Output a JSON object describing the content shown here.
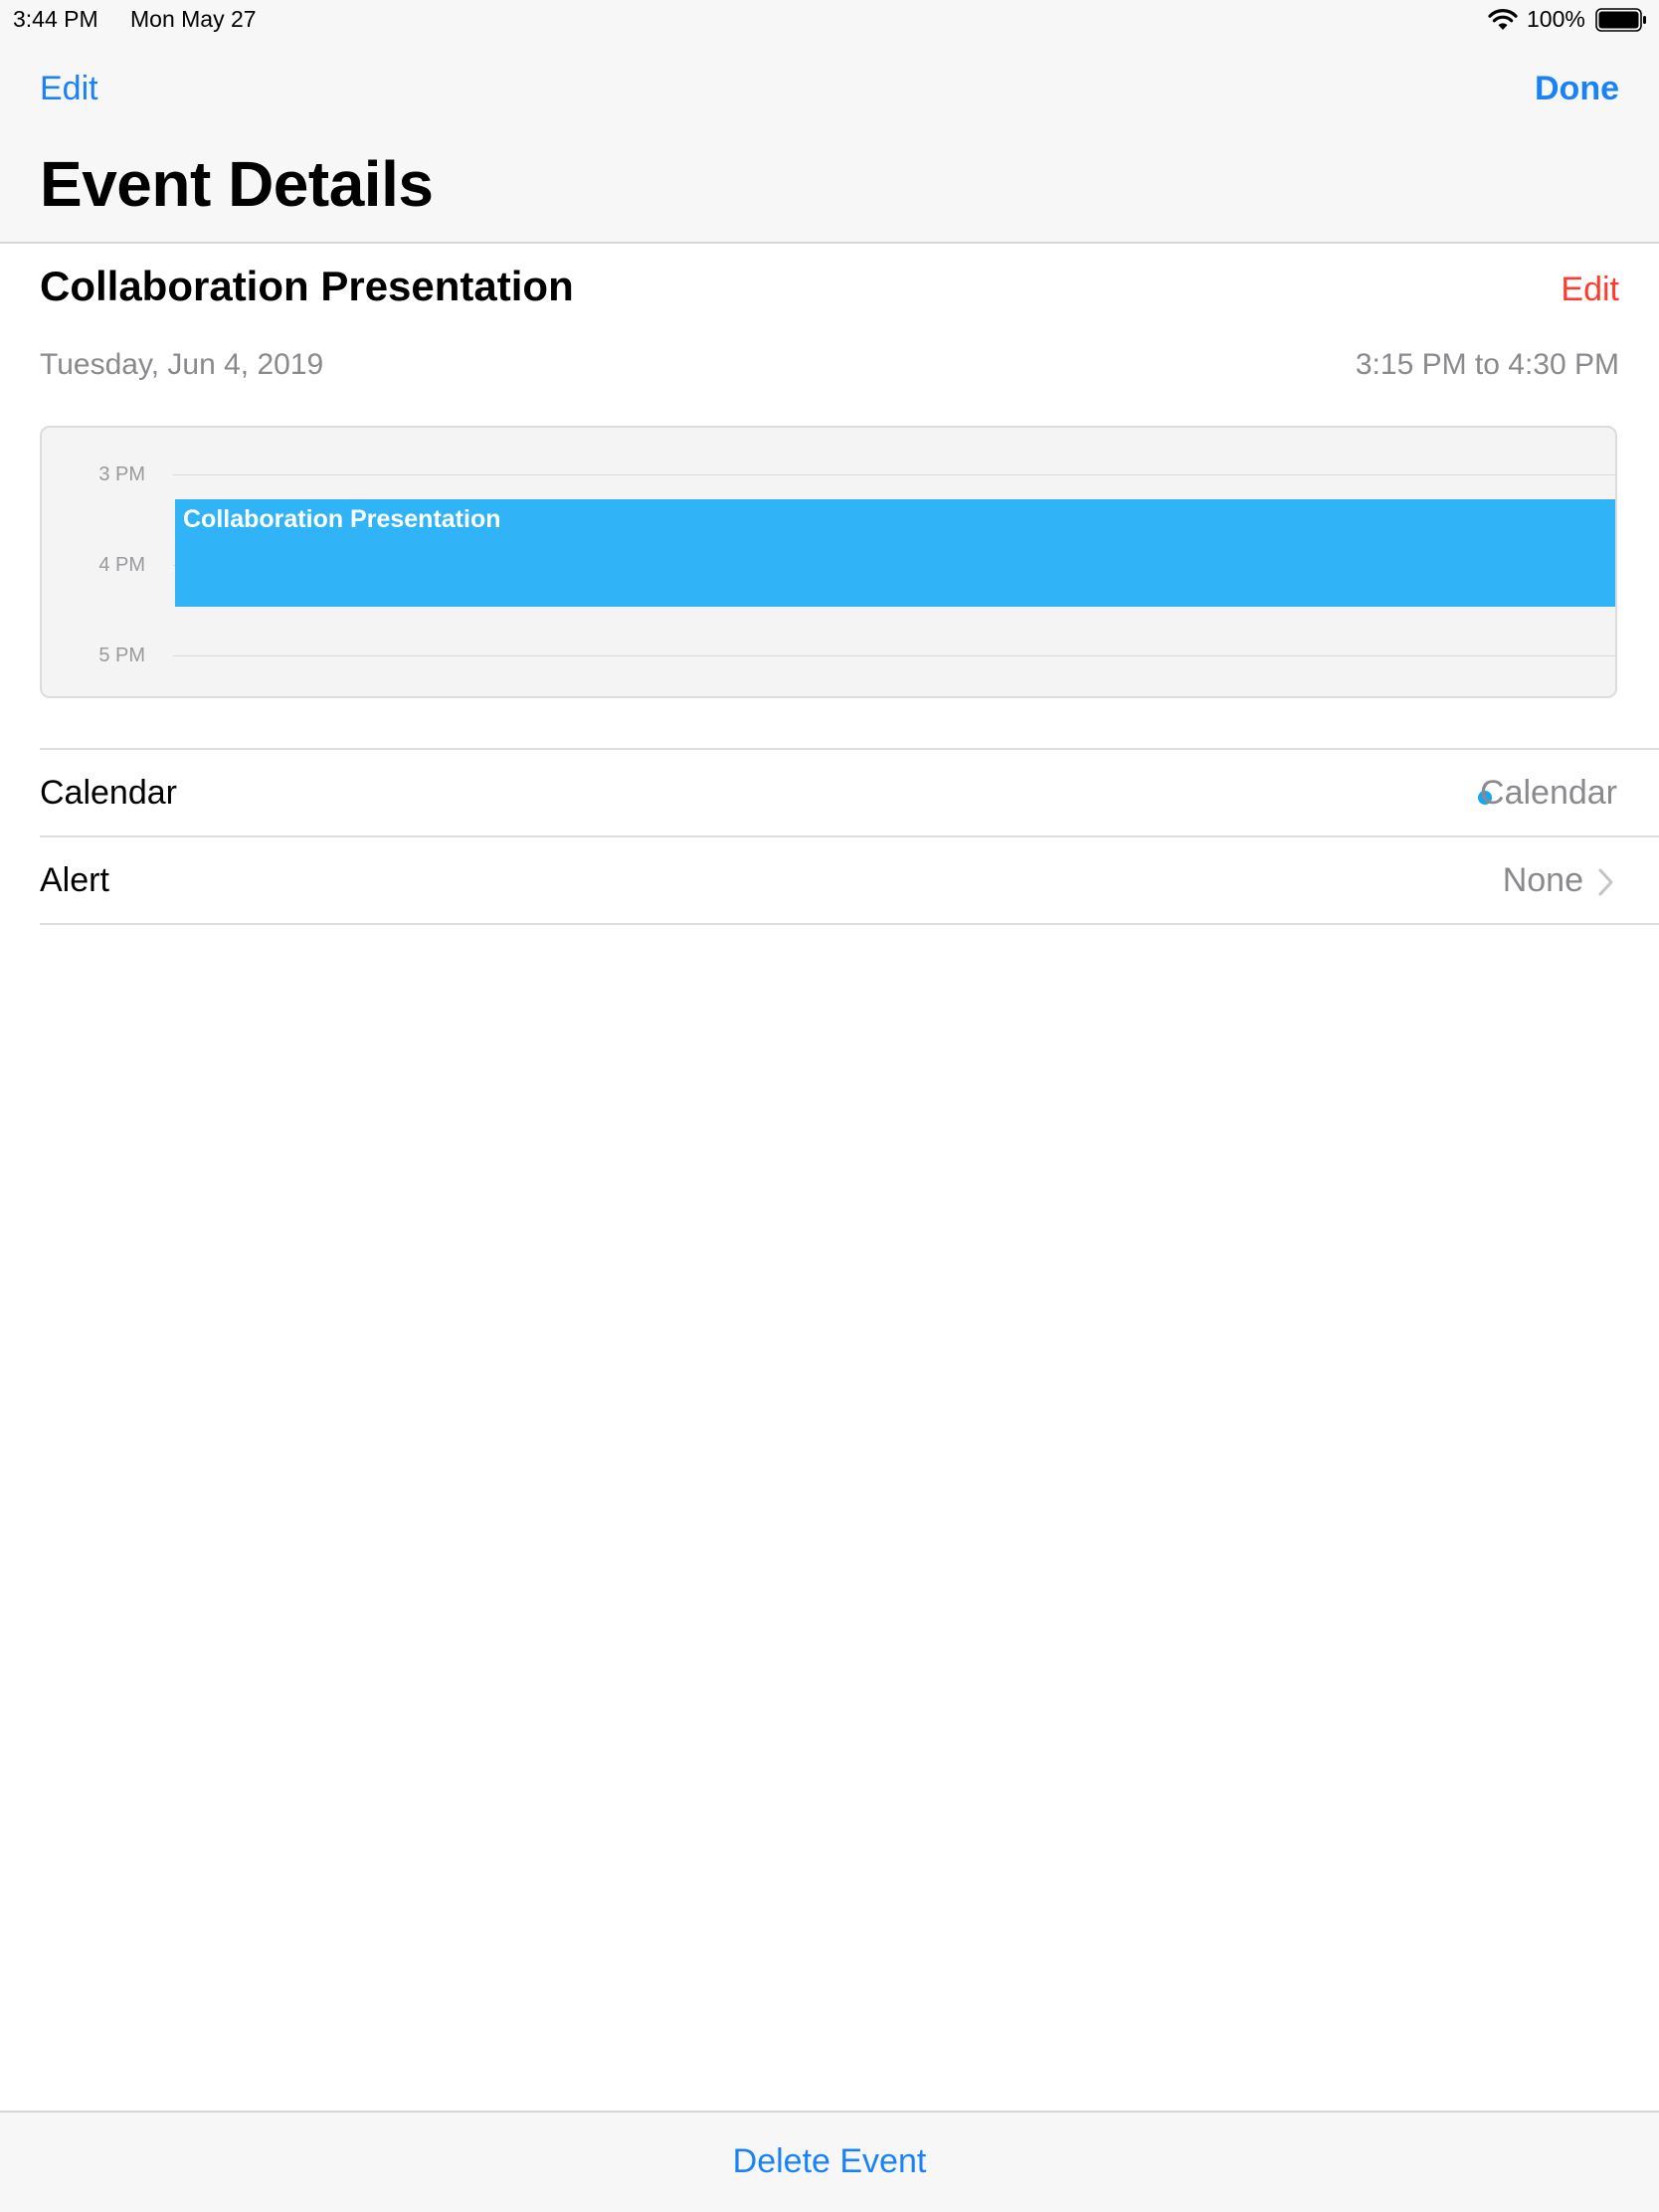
{
  "status_bar": {
    "time": "3:44 PM",
    "date": "Mon May 27",
    "battery_percent": "100%",
    "battery_level": 1.0,
    "icons": [
      "wifi-icon",
      "battery-icon"
    ]
  },
  "nav": {
    "edit_label": "Edit",
    "done_label": "Done",
    "title": "Event Details"
  },
  "event": {
    "title": "Collaboration Presentation",
    "edit_label": "Edit",
    "date": "Tuesday, Jun 4, 2019",
    "time_range": "3:15 PM to 4:30 PM",
    "color": "#31b3f7"
  },
  "timeline": {
    "hours": [
      "3 PM",
      "4 PM",
      "5 PM"
    ],
    "block_label": "Collaboration Presentation"
  },
  "details": {
    "calendar_label": "Calendar",
    "calendar_value": "Calendar",
    "calendar_color": "#1aa7f0",
    "alert_label": "Alert",
    "alert_value": "None"
  },
  "toolbar": {
    "delete_label": "Delete Event"
  },
  "colors": {
    "accent": "#1a82f7",
    "destructive": "#ff3b30",
    "secondary_text": "#8a8a8e"
  }
}
